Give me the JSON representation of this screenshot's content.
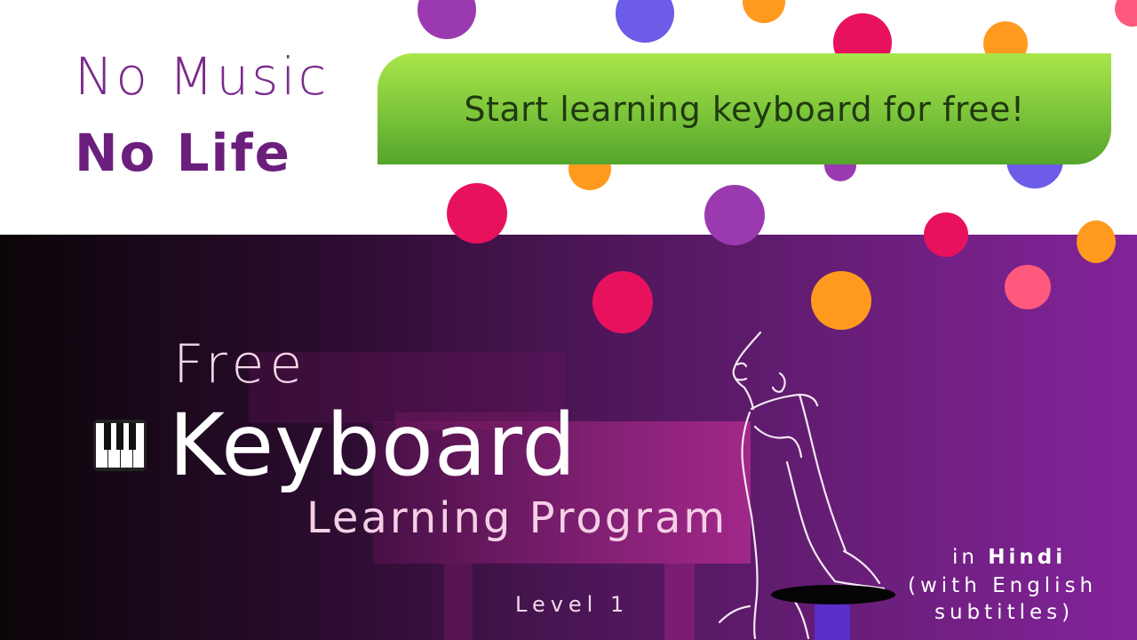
{
  "header": {
    "slogan_line1": "No Music",
    "slogan_line2": "No Life",
    "cta_label": "Start learning keyboard for free!"
  },
  "hero": {
    "title_free": "Free",
    "title_keyboard": "Keyboard",
    "title_program": "Learning Program",
    "level": "Level 1",
    "language_prefix": "in ",
    "language": "Hindi",
    "subtitle_line1": "(with English",
    "subtitle_line2": "subtitles)"
  },
  "colors": {
    "purple": "#9b3ab0",
    "violet": "#6c5ce7",
    "orange": "#ff9a1f",
    "crimson": "#e8115e",
    "pink": "#ff5a7e",
    "cta_green": "#7cc43a"
  },
  "icons": [
    "piano-keys-icon",
    "pianist-illustration"
  ]
}
